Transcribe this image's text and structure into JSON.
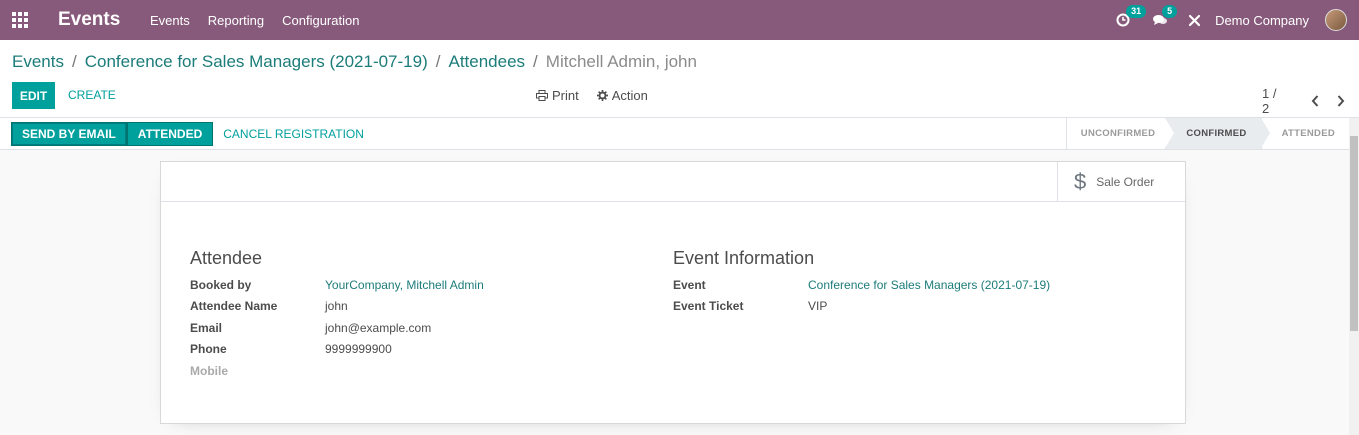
{
  "navbar": {
    "app_title": "Events",
    "menu": [
      "Events",
      "Reporting",
      "Configuration"
    ],
    "activity_count": "31",
    "message_count": "5",
    "company": "Demo Company"
  },
  "breadcrumb": {
    "items": [
      "Events",
      "Conference for Sales Managers (2021-07-19)",
      "Attendees"
    ],
    "current": "Mitchell Admin, john"
  },
  "control": {
    "edit_label": "EDIT",
    "create_label": "CREATE",
    "print_label": "Print",
    "action_label": "Action",
    "pager": "1 / 2"
  },
  "statusbar": {
    "send_email_label": "SEND BY EMAIL",
    "attended_label": "ATTENDED",
    "cancel_label": "CANCEL REGISTRATION",
    "stages": [
      "UNCONFIRMED",
      "CONFIRMED",
      "ATTENDED"
    ],
    "current_stage": "CONFIRMED"
  },
  "smart_buttons": {
    "sale_order_label": "Sale Order"
  },
  "attendee": {
    "title": "Attendee",
    "fields": [
      {
        "label": "Booked by",
        "value": "YourCompany, Mitchell Admin"
      },
      {
        "label": "Attendee Name",
        "value": "john"
      },
      {
        "label": "Email",
        "value": "john@example.com"
      },
      {
        "label": "Phone",
        "value": "9999999900"
      },
      {
        "label": "Mobile",
        "value": ""
      }
    ]
  },
  "event_info": {
    "title": "Event Information",
    "fields": [
      {
        "label": "Event",
        "value": "Conference for Sales Managers (2021-07-19)"
      },
      {
        "label": "Event Ticket",
        "value": "VIP"
      }
    ]
  },
  "colors": {
    "navbar": "#875a7b",
    "primary": "#00a09d",
    "link": "#1c7c7a"
  }
}
